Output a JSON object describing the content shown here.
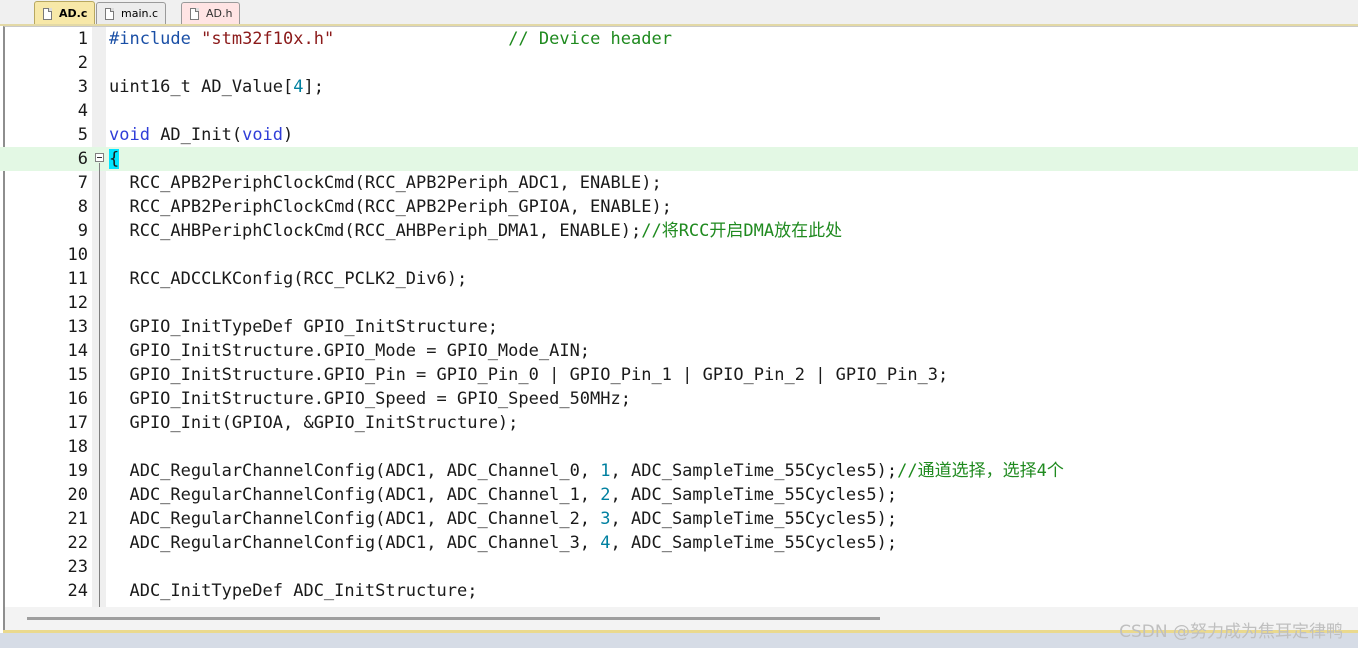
{
  "tabs": [
    {
      "label": "AD.c",
      "active": true
    },
    {
      "label": "main.c",
      "active": false
    },
    {
      "label": "AD.h",
      "active": false
    }
  ],
  "editor": {
    "highlighted_line": 6,
    "lines": [
      {
        "n": "1",
        "segs": [
          [
            "pp",
            "#include "
          ],
          [
            "str",
            "\"stm32f10x.h\""
          ],
          [
            "t",
            "                 "
          ],
          [
            "cm",
            "// Device header"
          ]
        ]
      },
      {
        "n": "2",
        "segs": []
      },
      {
        "n": "3",
        "segs": [
          [
            "t",
            "uint16_t AD_Value["
          ],
          [
            "num",
            "4"
          ],
          [
            "t",
            "];"
          ]
        ]
      },
      {
        "n": "4",
        "segs": []
      },
      {
        "n": "5",
        "segs": [
          [
            "kw",
            "void"
          ],
          [
            "t",
            " AD_Init("
          ],
          [
            "kw",
            "void"
          ],
          [
            "t",
            ")"
          ]
        ]
      },
      {
        "n": "6",
        "segs": [
          [
            "brace",
            "{"
          ]
        ]
      },
      {
        "n": "7",
        "segs": [
          [
            "t",
            "  RCC_APB2PeriphClockCmd(RCC_APB2Periph_ADC1, ENABLE);"
          ]
        ]
      },
      {
        "n": "8",
        "segs": [
          [
            "t",
            "  RCC_APB2PeriphClockCmd(RCC_APB2Periph_GPIOA, ENABLE);"
          ]
        ]
      },
      {
        "n": "9",
        "segs": [
          [
            "t",
            "  RCC_AHBPeriphClockCmd(RCC_AHBPeriph_DMA1, ENABLE);"
          ],
          [
            "cm",
            "//将RCC开启DMA放在此处"
          ]
        ]
      },
      {
        "n": "10",
        "segs": []
      },
      {
        "n": "11",
        "segs": [
          [
            "t",
            "  RCC_ADCCLKConfig(RCC_PCLK2_Div6);"
          ]
        ]
      },
      {
        "n": "12",
        "segs": []
      },
      {
        "n": "13",
        "segs": [
          [
            "t",
            "  GPIO_InitTypeDef GPIO_InitStructure;"
          ]
        ]
      },
      {
        "n": "14",
        "segs": [
          [
            "t",
            "  GPIO_InitStructure.GPIO_Mode = GPIO_Mode_AIN;"
          ]
        ]
      },
      {
        "n": "15",
        "segs": [
          [
            "t",
            "  GPIO_InitStructure.GPIO_Pin = GPIO_Pin_0 | GPIO_Pin_1 | GPIO_Pin_2 | GPIO_Pin_3;"
          ]
        ]
      },
      {
        "n": "16",
        "segs": [
          [
            "t",
            "  GPIO_InitStructure.GPIO_Speed = GPIO_Speed_50MHz;"
          ]
        ]
      },
      {
        "n": "17",
        "segs": [
          [
            "t",
            "  GPIO_Init(GPIOA, &GPIO_InitStructure);"
          ]
        ]
      },
      {
        "n": "18",
        "segs": []
      },
      {
        "n": "19",
        "segs": [
          [
            "t",
            "  ADC_RegularChannelConfig(ADC1, ADC_Channel_0, "
          ],
          [
            "num",
            "1"
          ],
          [
            "t",
            ", ADC_SampleTime_55Cycles5);"
          ],
          [
            "cm",
            "//通道选择，选择4个"
          ]
        ]
      },
      {
        "n": "20",
        "segs": [
          [
            "t",
            "  ADC_RegularChannelConfig(ADC1, ADC_Channel_1, "
          ],
          [
            "num",
            "2"
          ],
          [
            "t",
            ", ADC_SampleTime_55Cycles5);"
          ]
        ]
      },
      {
        "n": "21",
        "segs": [
          [
            "t",
            "  ADC_RegularChannelConfig(ADC1, ADC_Channel_2, "
          ],
          [
            "num",
            "3"
          ],
          [
            "t",
            ", ADC_SampleTime_55Cycles5);"
          ]
        ]
      },
      {
        "n": "22",
        "segs": [
          [
            "t",
            "  ADC_RegularChannelConfig(ADC1, ADC_Channel_3, "
          ],
          [
            "num",
            "4"
          ],
          [
            "t",
            ", ADC_SampleTime_55Cycles5);"
          ]
        ]
      },
      {
        "n": "23",
        "segs": []
      },
      {
        "n": "24",
        "segs": [
          [
            "t",
            "  ADC_InitTypeDef ADC_InitStructure;"
          ]
        ]
      }
    ]
  },
  "watermark": "CSDN @努力成为焦耳定律鸭",
  "icons": {
    "tab_file": "file-icon",
    "fold": "fold-minus-icon"
  }
}
